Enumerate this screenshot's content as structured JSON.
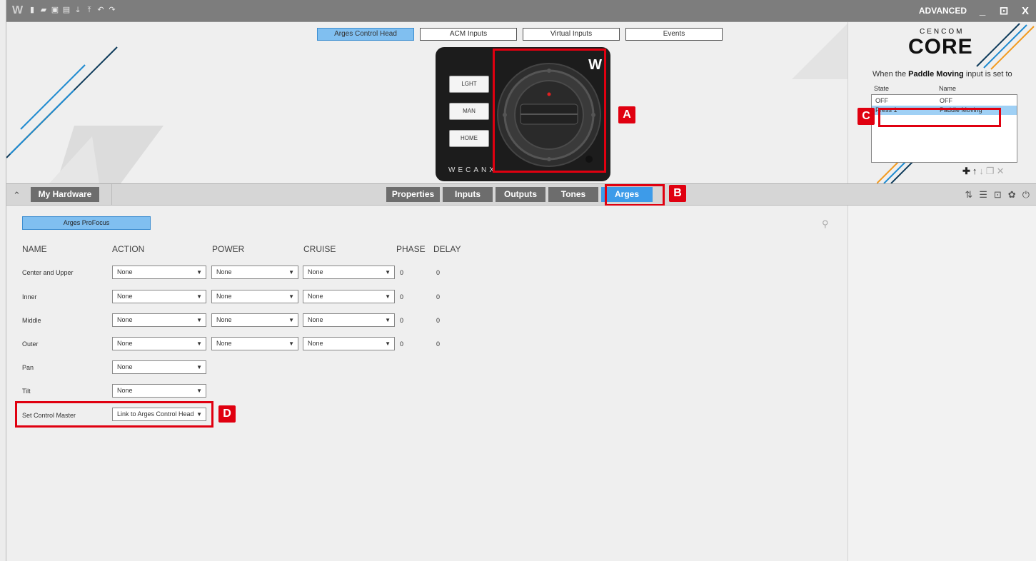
{
  "toolbar": {
    "app_logo": "W",
    "icons": [
      "new-file-icon",
      "open-folder-icon",
      "save-icon",
      "print-icon",
      "download-icon",
      "upload-icon",
      "undo-icon",
      "redo-icon"
    ],
    "mode_label": "ADVANCED",
    "minimize": "_",
    "restore": "⊡",
    "close": "X"
  },
  "mode_tabs": [
    {
      "label": "Arges Control Head",
      "active": true
    },
    {
      "label": "ACM Inputs",
      "active": false
    },
    {
      "label": "Virtual Inputs",
      "active": false
    },
    {
      "label": "Events",
      "active": false
    }
  ],
  "device": {
    "buttons": [
      "LGHT",
      "MAN",
      "HOME"
    ],
    "logo": "W",
    "brand": "WECANX"
  },
  "callouts": {
    "a": "A",
    "b": "B",
    "c": "C",
    "d": "D"
  },
  "right_panel": {
    "brand_top": "CENCOM",
    "brand_main": "CORE",
    "sentence_prefix": "When the",
    "sentence_bold": "Paddle Moving",
    "sentence_suffix": "input is set to",
    "col_state": "State",
    "col_name": "Name",
    "rows": [
      {
        "state": "OFF",
        "name": "OFF",
        "selected": false
      },
      {
        "state": "Press 1",
        "name": "Paddle Moving",
        "selected": true
      }
    ]
  },
  "strip": {
    "my_hardware": "My Hardware",
    "tabs": [
      {
        "label": "Properties",
        "active": false
      },
      {
        "label": "Inputs",
        "active": false
      },
      {
        "label": "Outputs",
        "active": false
      },
      {
        "label": "Tones",
        "active": false
      },
      {
        "label": "Arges",
        "active": true
      }
    ]
  },
  "main": {
    "subtab": "Arges ProFocus",
    "headers": {
      "name": "NAME",
      "action": "ACTION",
      "power": "POWER",
      "cruise": "CRUISE",
      "phase": "PHASE",
      "delay": "DELAY"
    },
    "rows": [
      {
        "name": "Center and Upper",
        "action": "None",
        "power": "None",
        "cruise": "None",
        "phase": "0",
        "delay": "0"
      },
      {
        "name": "Inner",
        "action": "None",
        "power": "None",
        "cruise": "None",
        "phase": "0",
        "delay": "0"
      },
      {
        "name": "Middle",
        "action": "None",
        "power": "None",
        "cruise": "None",
        "phase": "0",
        "delay": "0"
      },
      {
        "name": "Outer",
        "action": "None",
        "power": "None",
        "cruise": "None",
        "phase": "0",
        "delay": "0"
      },
      {
        "name": "Pan",
        "action": "None"
      },
      {
        "name": "Tilt",
        "action": "None"
      },
      {
        "name": "Set Control Master",
        "action": "Link to Arges Control Head"
      }
    ]
  },
  "colors": {
    "accent": "#3d9be9",
    "highlight": "#e00010",
    "tab_dark": "#6d6d6d"
  }
}
